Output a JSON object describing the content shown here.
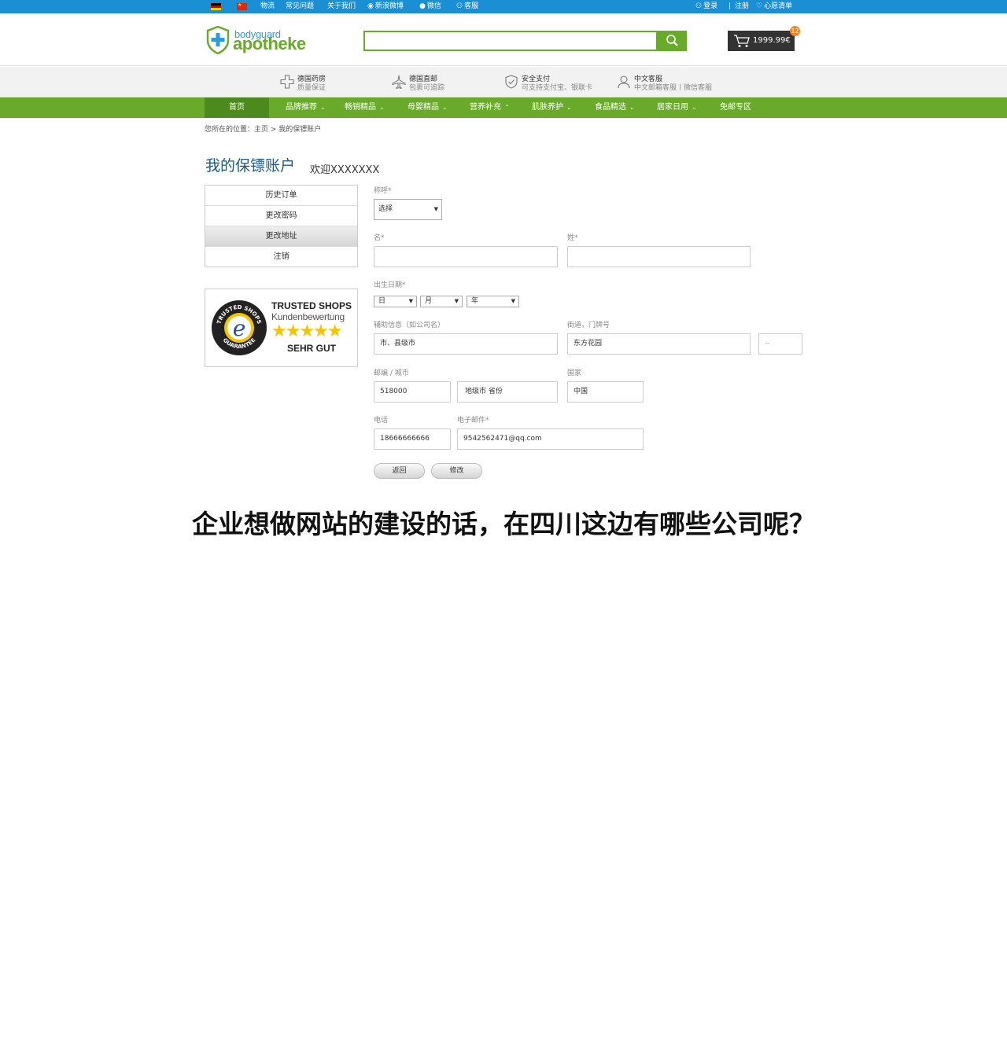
{
  "topbar": {
    "links": [
      "物流",
      "常见问题",
      "关于我们",
      "新浪微博",
      "微信",
      "客服"
    ],
    "login": "登录",
    "sep": "|",
    "register": "注册",
    "wishlist": "心愿清单"
  },
  "header": {
    "logo_small": "bodyguard",
    "logo_big": "apotheke",
    "search_placeholder": "",
    "cart_price": "1999.99€",
    "cart_count": "12"
  },
  "services": [
    {
      "title": "德国药房",
      "subtitle": "质量保证"
    },
    {
      "title": "德国直邮",
      "subtitle": "包裹可追踪"
    },
    {
      "title": "安全支付",
      "subtitle": "可支持支付宝、银联卡"
    },
    {
      "title": "中文客服",
      "subtitle": "中文邮箱客服丨微信客服"
    }
  ],
  "nav": {
    "home": "首页",
    "items": [
      "品牌推荐",
      "畅销精品",
      "母婴精品",
      "营养补充",
      "肌肤养护",
      "食品精选",
      "居家日用",
      "免邮专区"
    ]
  },
  "breadcrumb": "您所在的位置：主页 > 我的保镖账户",
  "page_title": "我的保镖账户",
  "welcome": "欢迎XXXXXXX",
  "side_menu": [
    "历史订单",
    "更改密码",
    "更改地址",
    "注销"
  ],
  "trusted": {
    "line1": "TRUSTED SHOPS",
    "line2": "Kundenbewertung",
    "stars": "★★★★★",
    "line3": "SEHR GUT",
    "seal_top": "TRUSTED SHOPS",
    "seal_bottom": "GUARANTEE",
    "seal_letter": "e"
  },
  "form": {
    "salutation_label": "称呼*",
    "salutation_value": "选择",
    "first_name_label": "名*",
    "last_name_label": "姓*",
    "birthday_label": "出生日期*",
    "day": "日",
    "month": "月",
    "year": "年",
    "extra_label": "辅助信息（如公司名）",
    "extra_value": "市、县级市",
    "street_label": "街道，门牌号",
    "street_value": "东方花园",
    "house_no": "--",
    "zip_city_label": "邮编 / 城市",
    "zip_value": "518000",
    "city_value": "地级市  省份",
    "country_label": "国家",
    "country_value": "中国",
    "phone_label": "电话",
    "phone_value": "18666666666",
    "email_label": "电子邮件*",
    "email_value": "9542562471@qq.com",
    "back_button": "返回",
    "edit_button": "修改"
  },
  "banner": "企业想做网站的建设的话，在四川这边有哪些公司呢？"
}
